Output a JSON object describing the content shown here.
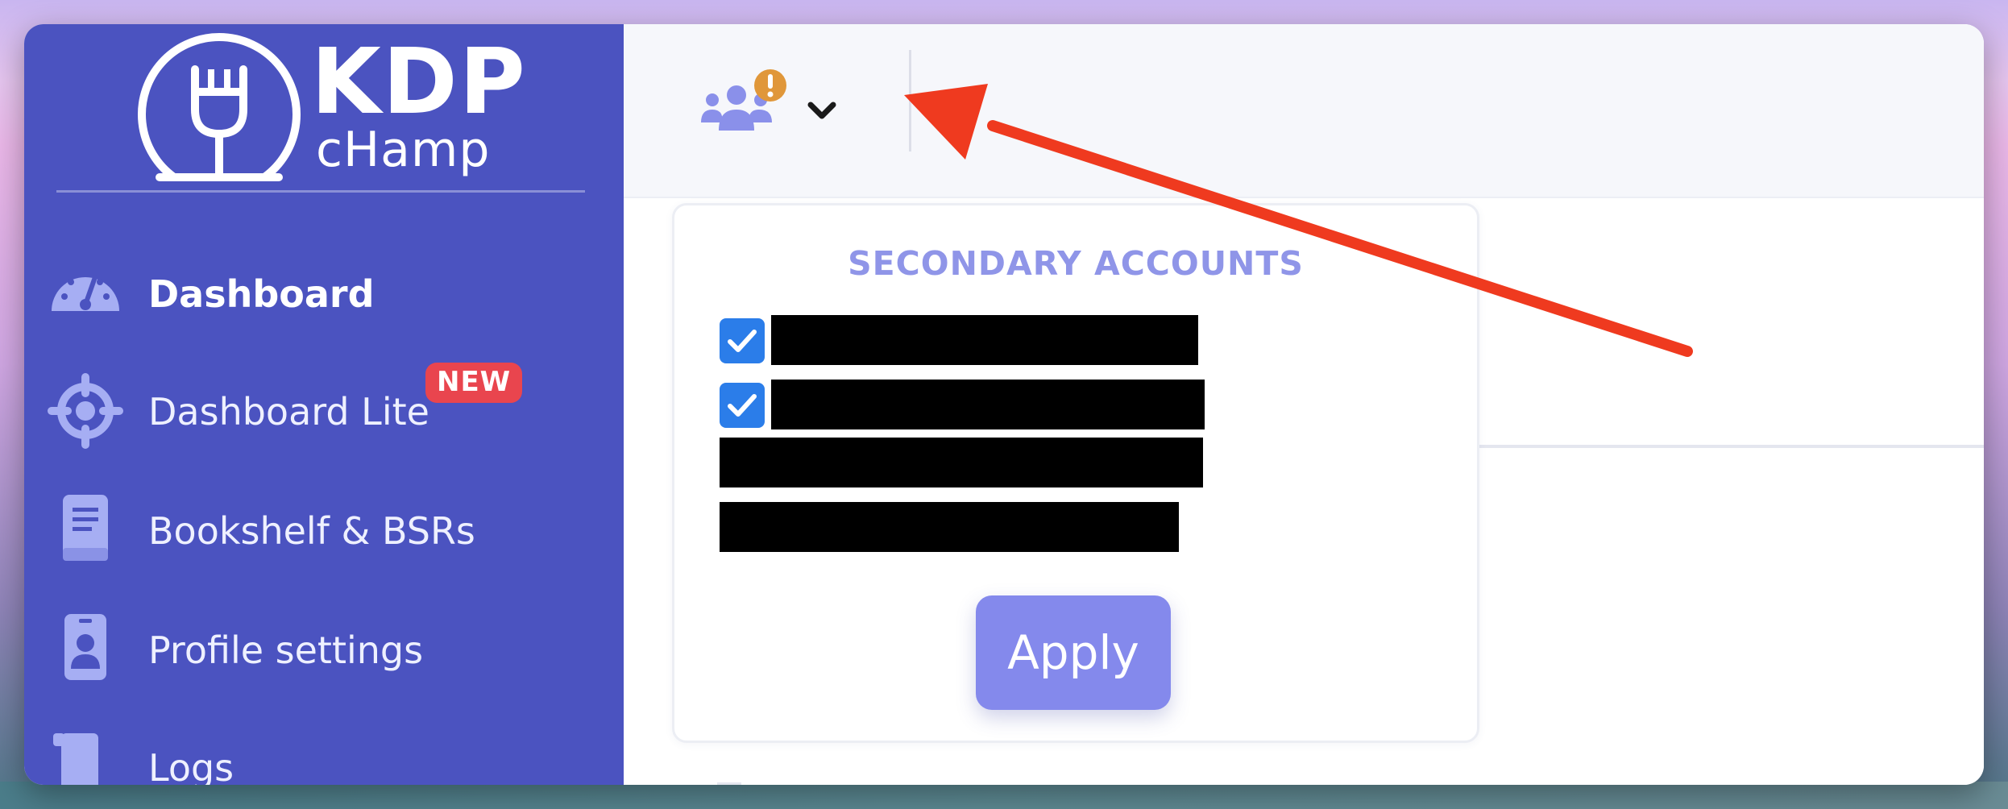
{
  "brand": {
    "line1": "KDP",
    "line2": "cHamp"
  },
  "sidebar": {
    "items": [
      {
        "label": "Dashboard",
        "icon": "gauge-icon",
        "active": true
      },
      {
        "label": "Dashboard Lite",
        "icon": "crosshair-icon",
        "badge": "NEW"
      },
      {
        "label": "Bookshelf & BSRs",
        "icon": "book-icon"
      },
      {
        "label": "Profile settings",
        "icon": "id-badge-icon"
      },
      {
        "label": "Logs",
        "icon": "scroll-icon"
      }
    ]
  },
  "topbar": {
    "account_switcher": {
      "icon": "users-icon",
      "alert_icon": "exclamation-icon",
      "caret_icon": "chevron-down-icon"
    }
  },
  "secondary_accounts": {
    "title": "SECONDARY ACCOUNTS",
    "accounts": [
      {
        "checked": true,
        "redacted": true
      },
      {
        "checked": true,
        "redacted": true
      },
      {
        "checked": false,
        "redacted": true
      },
      {
        "checked": false,
        "redacted": true
      }
    ],
    "apply_label": "Apply"
  },
  "colors": {
    "sidebar": "#4b53c0",
    "accent": "#8489ec",
    "title": "#8f95e8",
    "badge": "#e9454e",
    "checkbox": "#2b7de9",
    "alert": "#e0973a",
    "arrow": "#ef3a1f"
  },
  "annotation": {
    "arrow_icon": "red-arrow-icon"
  }
}
